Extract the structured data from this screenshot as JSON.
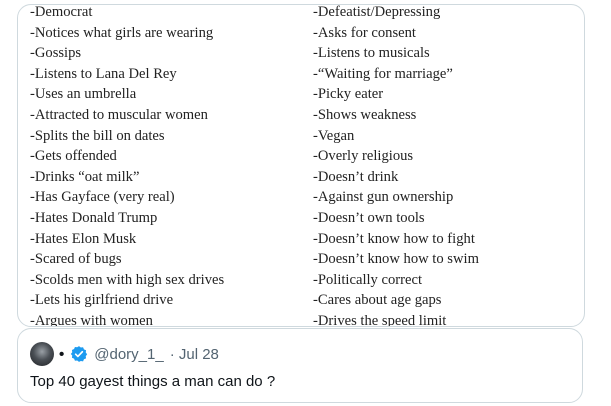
{
  "media": {
    "left_list": [
      "-Democrat",
      "-Notices what girls are wearing",
      "-Gossips",
      "-Listens to Lana Del Rey",
      "-Uses an umbrella",
      "-Attracted to muscular women",
      "-Splits the bill on dates",
      "-Gets offended",
      "-Drinks “oat milk”",
      "-Has Gayface (very real)",
      "-Hates Donald Trump",
      "-Hates Elon Musk",
      "-Scared of bugs",
      "-Scolds men with high sex drives",
      "-Lets his girlfriend drive",
      "-Argues with women"
    ],
    "right_list": [
      "-Defeatist/Depressing",
      "-Asks for consent",
      "-Listens to musicals",
      "-“Waiting for marriage”",
      "-Picky eater",
      "-Shows weakness",
      "-Vegan",
      "-Overly religious",
      "-Doesn’t drink",
      "-Against gun ownership",
      "-Doesn’t own tools",
      "-Doesn’t know how to fight",
      "-Doesn’t know how to swim",
      "-Politically correct",
      "-Cares about age gaps",
      "-Drives the speed limit"
    ]
  },
  "quote": {
    "separator": "•",
    "handle": "@dory_1_",
    "time": "· Jul 28",
    "text": "Top 40 gayest things a man can do ?",
    "icons": {
      "avatar": "avatar-photo",
      "verified": "verified-badge-icon"
    },
    "colors": {
      "verified": "#1d9bf0",
      "meta": "#536471",
      "text": "#0f1419"
    }
  }
}
